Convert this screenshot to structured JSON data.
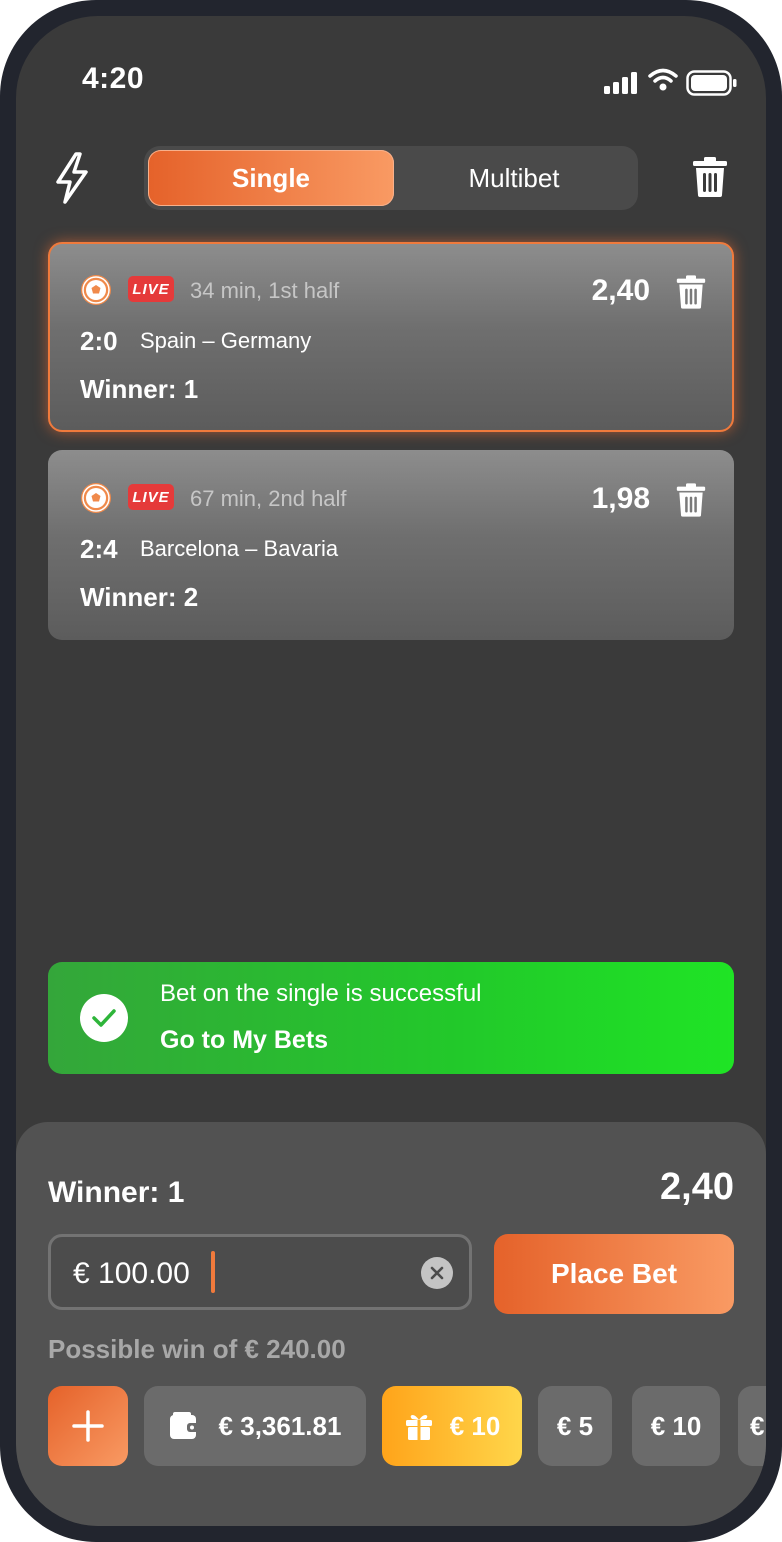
{
  "status_bar": {
    "time": "4:20"
  },
  "header": {
    "tabs": [
      {
        "label": "Single",
        "active": true
      },
      {
        "label": "Multibet",
        "active": false
      }
    ]
  },
  "bets": [
    {
      "live_badge": "LIVE",
      "match_time": "34 min, 1st half",
      "odds": "2,40",
      "score": "2:0",
      "teams": "Spain – Germany",
      "market": "Winner: 1",
      "selected": true
    },
    {
      "live_badge": "LIVE",
      "match_time": "67 min, 2nd half",
      "odds": "1,98",
      "score": "2:4",
      "teams": "Barcelona – Bavaria",
      "market": "Winner: 2",
      "selected": false
    }
  ],
  "toast": {
    "message": "Bet on the single is successful",
    "link": "Go to My Bets"
  },
  "bet_slip": {
    "selection": "Winner: 1",
    "odds": "2,40",
    "stake_value": "€ 100.00",
    "place_bet_label": "Place Bet",
    "possible_win": "Possible win of € 240.00",
    "chips": {
      "balance": "€ 3,361.81",
      "bonus": "€ 10",
      "amount_5": "€ 5",
      "amount_10": "€ 10",
      "partial": "€"
    }
  },
  "colors": {
    "accent": "#f07a3c",
    "success": "#22c92a",
    "live": "#e53a3a",
    "bonus": "#ffc02e"
  },
  "icons": [
    "bolt-icon",
    "trash-icon",
    "soccer-ball-icon",
    "check-icon",
    "clear-icon",
    "plus-icon",
    "wallet-icon",
    "gift-icon"
  ]
}
